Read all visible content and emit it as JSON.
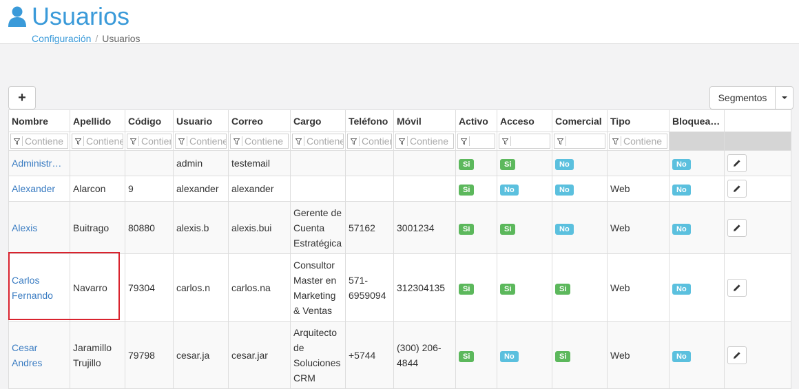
{
  "header": {
    "title": "Usuarios",
    "breadcrumb": {
      "link": "Configuración",
      "separator": "/",
      "current": "Usuarios"
    },
    "icon": "user-icon",
    "accent_color": "#3a9ad9"
  },
  "toolbar": {
    "add_label": "+",
    "segments_label": "Segmentos"
  },
  "table": {
    "columns": [
      "Nombre",
      "Apellido",
      "Código",
      "Usuario",
      "Correo",
      "Cargo",
      "Teléfono",
      "Móvil",
      "Activo",
      "Acceso",
      "Comercial",
      "Tipo",
      "Bloqueado"
    ],
    "filter_placeholder": "Contiene",
    "rows": [
      {
        "nombre": "Administrador",
        "apellido": "",
        "codigo": "",
        "usuario": "admin",
        "correo": "testemail",
        "cargo": "",
        "telefono": "",
        "movil": "",
        "activo": "Si",
        "acceso": "Si",
        "comercial": "No",
        "tipo": "",
        "bloqueado": "No"
      },
      {
        "nombre": "Alexander",
        "apellido": "Alarcon",
        "codigo": "9",
        "usuario": "alexander",
        "correo": "alexander",
        "cargo": "",
        "telefono": "",
        "movil": "",
        "activo": "Si",
        "acceso": "No",
        "comercial": "No",
        "tipo": "Web",
        "bloqueado": "No"
      },
      {
        "nombre": "Alexis",
        "apellido": "Buitrago",
        "codigo": "80880",
        "usuario": "alexis.b",
        "correo": "alexis.bui",
        "cargo": "Gerente de Cuenta Estratégica",
        "telefono": "57162",
        "movil": "3001234",
        "activo": "Si",
        "acceso": "Si",
        "comercial": "No",
        "tipo": "Web",
        "bloqueado": "No"
      },
      {
        "nombre": "Carlos Fernando",
        "apellido": "Navarro",
        "codigo": "79304",
        "usuario": "carlos.n",
        "correo": "carlos.na",
        "cargo": "Consultor Master en Marketing & Ventas",
        "telefono": "571-6959094",
        "movil": "312304135",
        "activo": "Si",
        "acceso": "Si",
        "comercial": "Si",
        "tipo": "Web",
        "bloqueado": "No"
      },
      {
        "nombre": "Cesar Andres",
        "apellido": "Jaramillo Trujillo",
        "codigo": "79798",
        "usuario": "cesar.ja",
        "correo": "cesar.jar",
        "cargo": "Arquitecto de Soluciones CRM",
        "telefono": "+5744",
        "movil": "(300) 206-4844",
        "activo": "Si",
        "acceso": "No",
        "comercial": "Si",
        "tipo": "Web",
        "bloqueado": "No"
      }
    ]
  },
  "colors": {
    "badge_si": "#5cb85c",
    "badge_no": "#5bc0de",
    "highlight": "#d9232e"
  }
}
